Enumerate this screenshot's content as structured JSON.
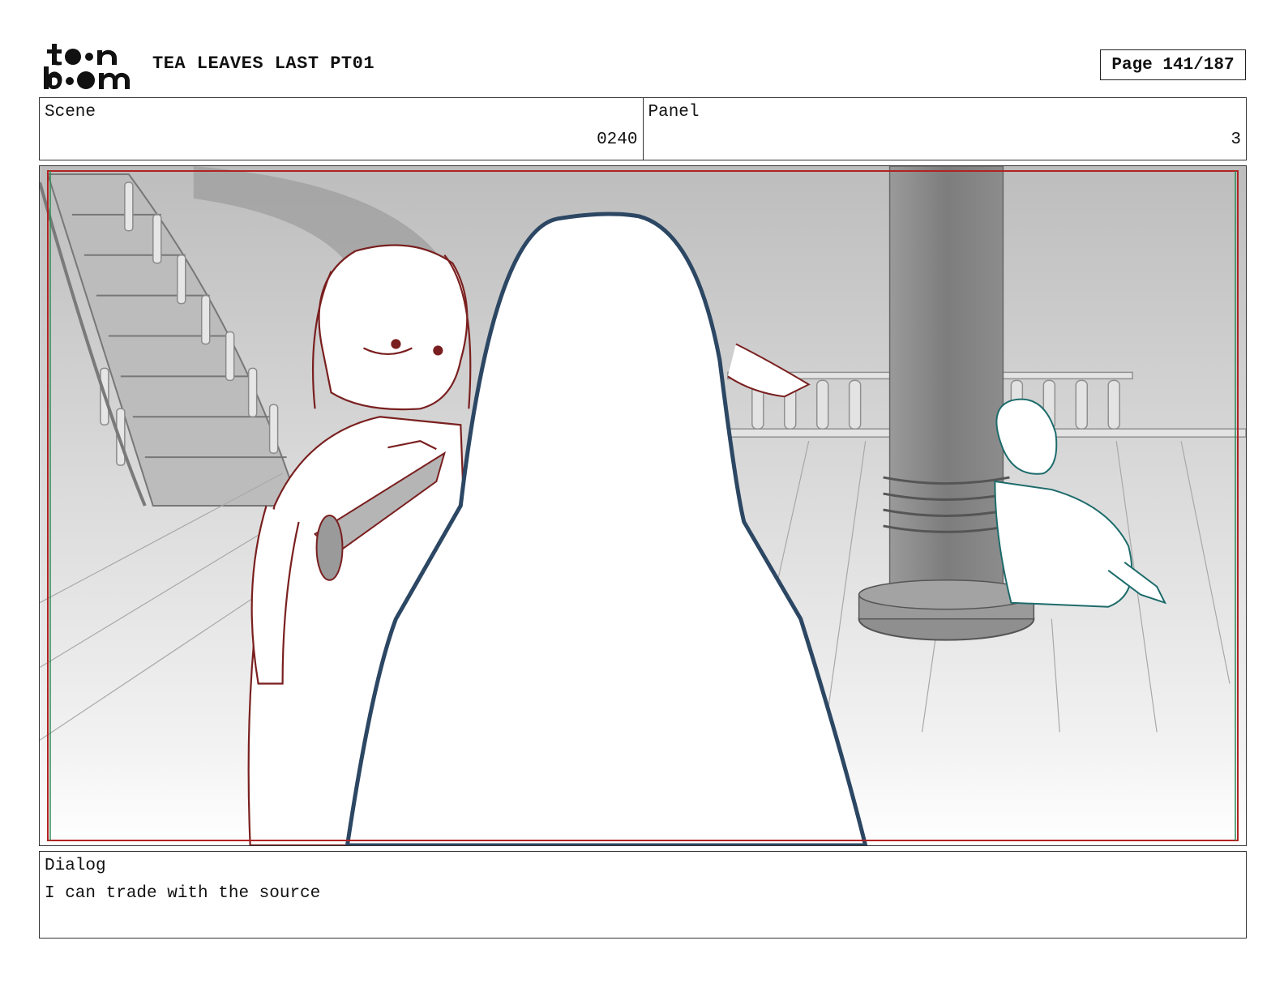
{
  "header": {
    "logo_alt": "toon boom",
    "title": "TEA LEAVES LAST PT01",
    "page_label": "Page 141/187"
  },
  "info": {
    "scene_label": "Scene",
    "scene_value": "0240",
    "panel_label": "Panel",
    "panel_value": "3"
  },
  "frame": {
    "description_icon": "storyboard-drawing",
    "safe_frame_color": "#b22222",
    "figure_colors": {
      "left_character": "#7a1f1f",
      "foreground_silhouette": "#2c4763",
      "right_character": "#1d6b6b"
    }
  },
  "dialog": {
    "label": "Dialog",
    "text": "I can trade with the source"
  }
}
